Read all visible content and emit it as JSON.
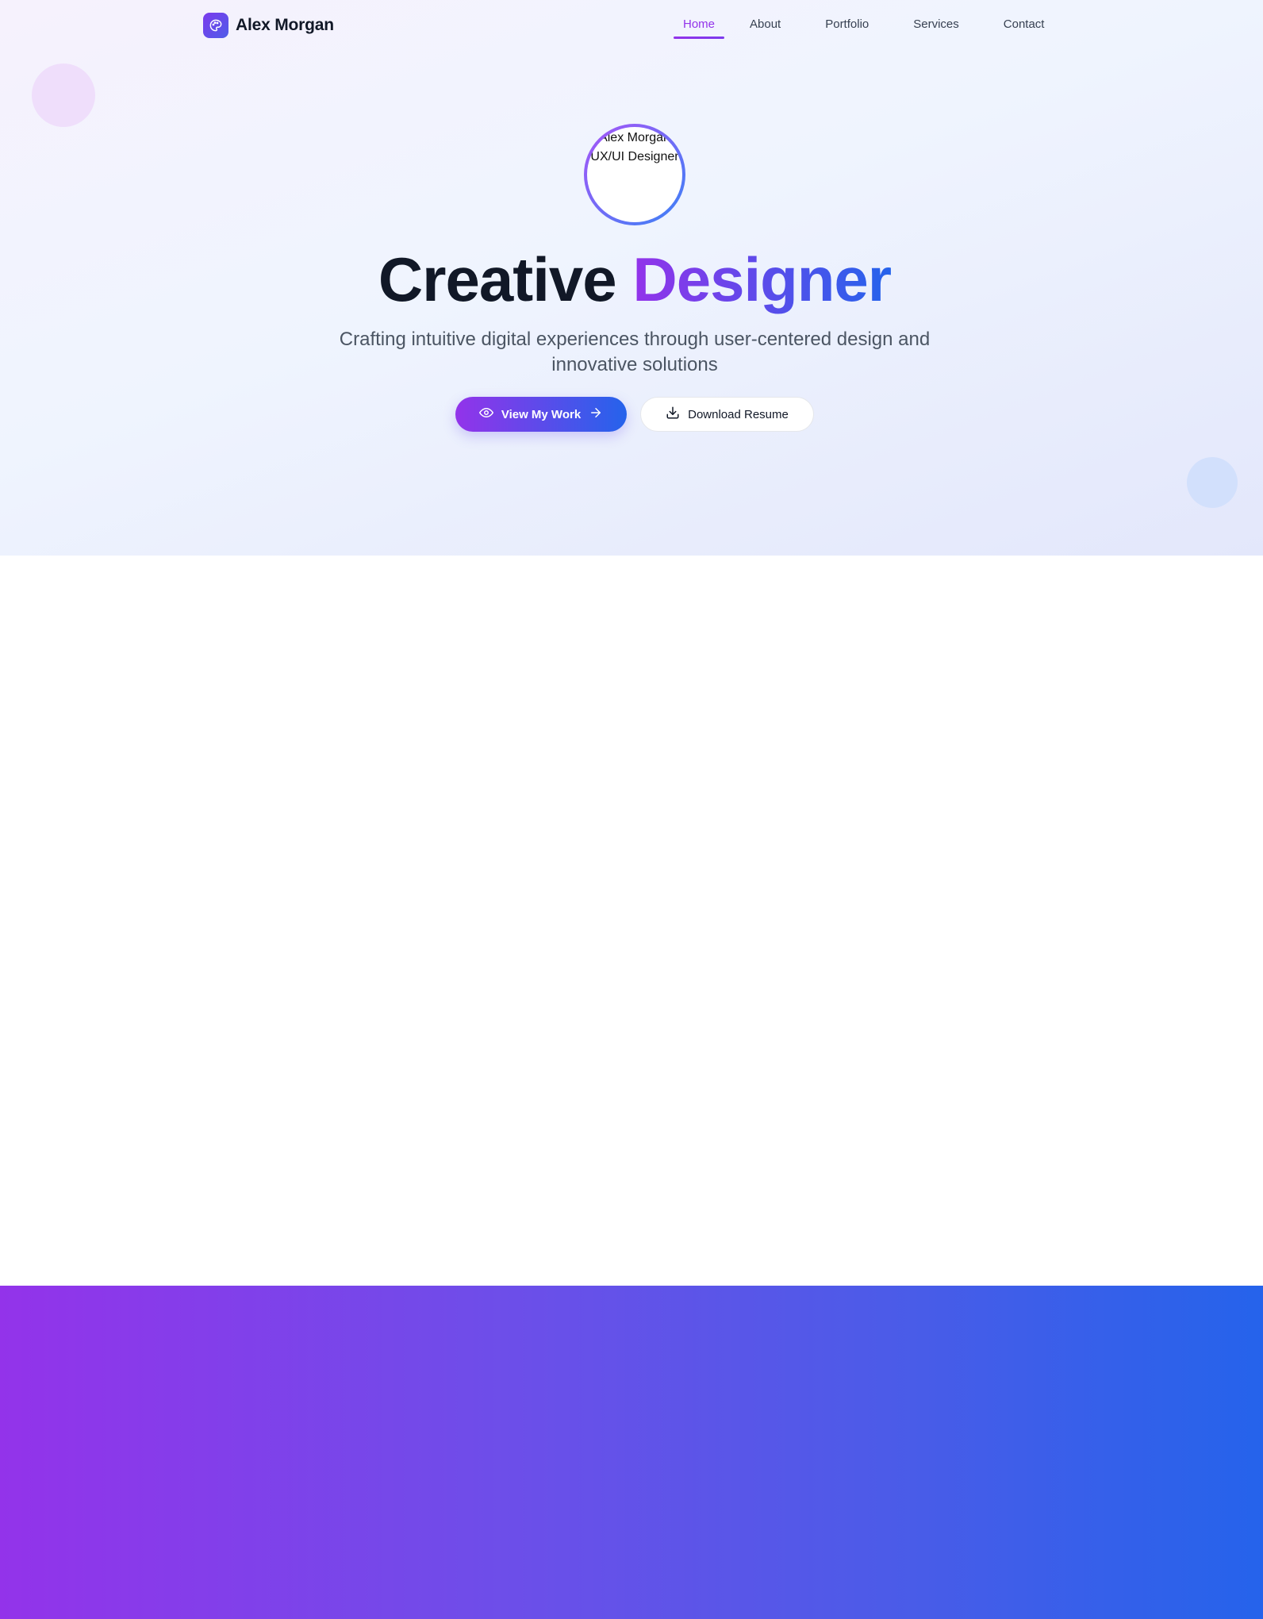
{
  "brand": {
    "name": "Alex Morgan",
    "logo_icon": "palette-icon"
  },
  "nav": {
    "items": [
      {
        "label": "Home",
        "active": true
      },
      {
        "label": "About",
        "active": false
      },
      {
        "label": "Portfolio",
        "active": false
      },
      {
        "label": "Services",
        "active": false
      },
      {
        "label": "Contact",
        "active": false
      }
    ]
  },
  "hero": {
    "avatar_alt_line1": "Alex Morgan",
    "avatar_alt_line2": "UX/UI Designer",
    "headline_plain": "Creative",
    "headline_accent": "Designer",
    "subtitle": "Crafting intuitive digital experiences through user-centered design and innovative solutions",
    "primary_button": {
      "label": "View My Work",
      "leading_icon": "eye-icon",
      "trailing_icon": "arrow-right-icon"
    },
    "secondary_button": {
      "label": "Download Resume",
      "icon": "download-icon"
    }
  },
  "colors": {
    "accent_purple": "#9333ea",
    "accent_blue": "#2563eb",
    "text_dark": "#111827",
    "text_muted": "#4b5563"
  }
}
